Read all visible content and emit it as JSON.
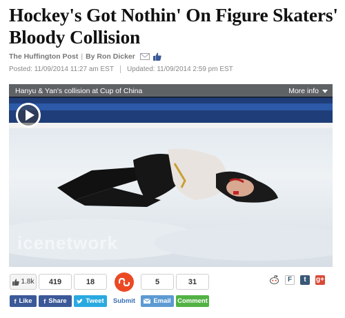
{
  "article": {
    "headline": "Hockey's Got Nothin' On Figure Skaters' Bloody Collision",
    "source": "The Huffington Post",
    "author": "By Ron Dicker",
    "posted": "Posted: 11/09/2014 11:27 am EST",
    "updated": "Updated: 11/09/2014 2:59 pm EST"
  },
  "video": {
    "caption": "Hanyu & Yan's collision at Cup of China",
    "more_info": "More info",
    "watermark": "icenetwork"
  },
  "share_counts": {
    "facebook": "1.8k",
    "share": "419",
    "tweet": "18",
    "stumble": "",
    "email": "5",
    "comment": "31"
  },
  "share_buttons": {
    "like": "Like",
    "share": "Share",
    "tweet": "Tweet",
    "submit": "Submit",
    "email": "Email",
    "comment": "Comment"
  },
  "colors": {
    "facebook": "#3b5998",
    "twitter": "#2aa9e0",
    "stumble": "#eb4924",
    "email": "#5d9ad2",
    "comment": "#52b244",
    "submit_text": "#3b6fb6"
  }
}
